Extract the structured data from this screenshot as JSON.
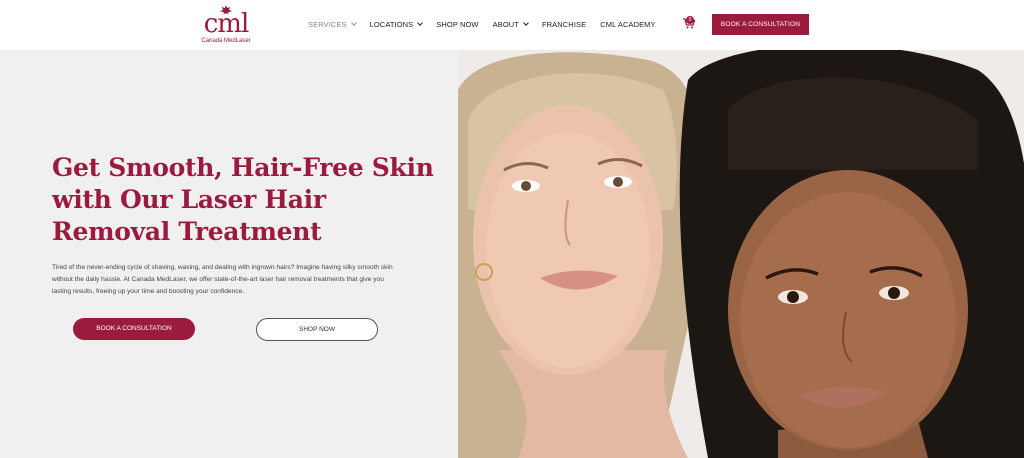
{
  "brand": {
    "logo_text": "cml",
    "logo_subtext": "Canada MedLaser",
    "color": "#9b1b3f"
  },
  "nav": {
    "items": [
      {
        "label": "SERVICES",
        "has_dropdown": true,
        "active": true
      },
      {
        "label": "LOCATIONS",
        "has_dropdown": true
      },
      {
        "label": "SHOP NOW",
        "has_dropdown": false
      },
      {
        "label": "ABOUT",
        "has_dropdown": true
      },
      {
        "label": "FRANCHISE",
        "has_dropdown": false
      },
      {
        "label": "CML ACADEMY",
        "has_dropdown": false
      }
    ],
    "cart_count": "0",
    "cart_icon": "cart-icon",
    "cta_label": "BOOK A CONSULTATION"
  },
  "hero": {
    "title": "Get Smooth, Hair-Free Skin with Our Laser Hair Removal Treatment",
    "description": "Tired of the never-ending cycle of shaving, waxing, and dealing with ingrown hairs? Imagine having silky smooth skin without the daily hassle. At Canada MedLaser, we offer state-of-the-art laser hair removal treatments that give you lasting results, freeing up your time and boosting your confidence.",
    "primary_button": "BOOK A CONSULTATION",
    "secondary_button": "SHOP NOW",
    "image_subject": "two-women-portrait"
  }
}
